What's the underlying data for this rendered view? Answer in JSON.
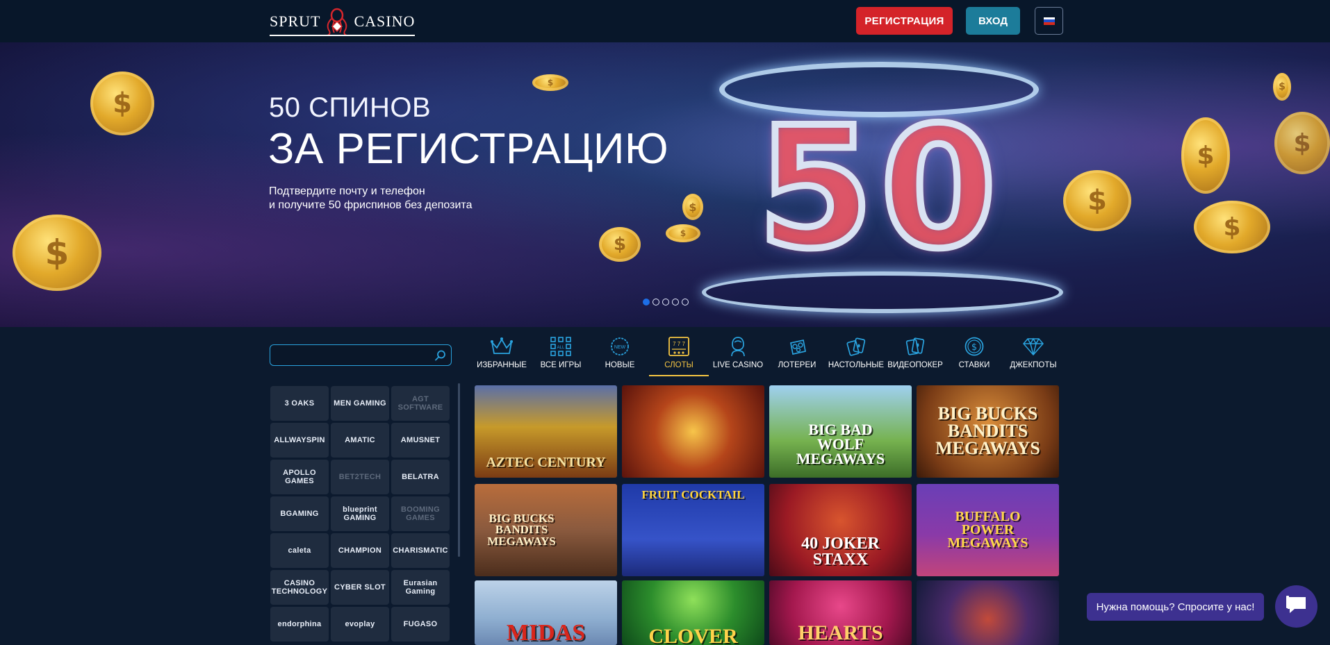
{
  "header": {
    "logo_left": "SPRUT",
    "logo_right": "CASINO",
    "register_label": "РЕГИСТРАЦИЯ",
    "login_label": "ВХОД",
    "language_icon": "russian-flag-icon"
  },
  "banner": {
    "subtitle": "50 СПИНОВ",
    "title": "ЗА РЕГИСТРАЦИЮ",
    "desc_line1": "Подтвердите почту и телефон",
    "desc_line2": "и получите 50 фриспинов без депозита",
    "big_number": [
      "5",
      "0"
    ],
    "slides_total": 5,
    "slide_active": 1
  },
  "search": {
    "placeholder": "",
    "value": ""
  },
  "categories": [
    {
      "label": "ИЗБРАННЫЕ",
      "icon": "crown-icon"
    },
    {
      "label": "ВСЕ ИГРЫ",
      "icon": "grid-all-icon"
    },
    {
      "label": "НОВЫЕ",
      "icon": "new-badge-icon"
    },
    {
      "label": "СЛОТЫ",
      "icon": "slot-machine-icon",
      "active": true
    },
    {
      "label": "LIVE CASINO",
      "icon": "dealer-icon"
    },
    {
      "label": "ЛОТЕРЕИ",
      "icon": "lottery-ball-icon"
    },
    {
      "label": "НАСТОЛЬНЫЕ",
      "icon": "playing-cards-icon"
    },
    {
      "label": "ВИДЕОПОКЕР",
      "icon": "poker-cards-icon"
    },
    {
      "label": "СТАВКИ",
      "icon": "dollar-coin-icon"
    },
    {
      "label": "ДЖЕКПОТЫ",
      "icon": "diamond-icon"
    }
  ],
  "providers": [
    "3 OAKS",
    "MEN GAMING",
    "AGT SOFTWARE",
    "ALLWAYSPIN",
    "AMATIC",
    "AMUSNET",
    "APOLLO GAMES",
    "BET2TECH",
    "BELATRA",
    "BGAMING",
    "blueprint GAMING",
    "BOOMING GAMES",
    "caleta",
    "CHAMPION",
    "CHARISMATIC",
    "CASINO TECHNOLOGY",
    "CYBER SLOT",
    "Eurasian Gaming",
    "endorphina",
    "evoplay",
    "FUGASO"
  ],
  "games": [
    {
      "title": "AZTEC CENTURY"
    },
    {
      "title": ""
    },
    {
      "title": "BIG BAD WOLF MEGAWAYS"
    },
    {
      "title": "BIG BUCKS BANDITS MEGAWAYS"
    },
    {
      "title": "BIG BUCKS BANDITS MEGAWAYS"
    },
    {
      "title": "FRUIT COCKTAIL"
    },
    {
      "title": "40 JOKER STAXX"
    },
    {
      "title": "BUFFALO POWER MEGAWAYS"
    },
    {
      "title": "MIDAS"
    },
    {
      "title": "CLOVER"
    },
    {
      "title": "HEARTS"
    },
    {
      "title": ""
    }
  ],
  "chat": {
    "label": "Нужна помощь? Спросите у нас!"
  },
  "colors": {
    "background": "#0c1a2e",
    "header": "#08172a",
    "register": "#d42329",
    "login": "#1c7c9a",
    "accent_active": "#f5c542",
    "chat": "#3d3190"
  }
}
